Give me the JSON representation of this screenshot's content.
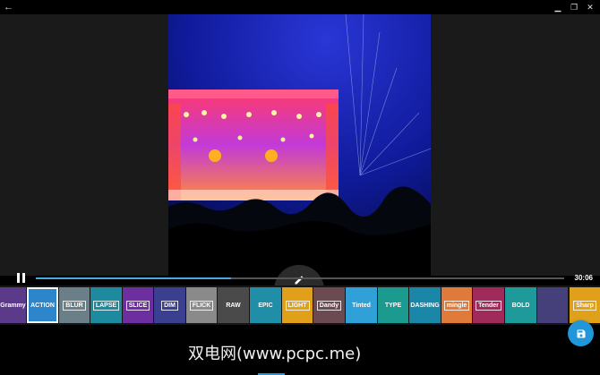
{
  "window": {
    "back_icon": "arrow-left-icon",
    "controls": [
      "minimize-icon",
      "restore-icon",
      "close-icon"
    ]
  },
  "player": {
    "state": "playing",
    "duration": "30:06",
    "progress": 0.37,
    "accent": "#4aa8e0"
  },
  "filters": [
    {
      "label": "Grammy",
      "bg": "#5b3a8a",
      "selected": false
    },
    {
      "label": "ACTION",
      "bg": "#2d86c9",
      "selected": true
    },
    {
      "label": "BLUR",
      "bg": "#6a7f88",
      "selected": false
    },
    {
      "label": "LAPSE",
      "bg": "#1d8aa0",
      "selected": false
    },
    {
      "label": "SLICE",
      "bg": "#6d2fa0",
      "selected": false
    },
    {
      "label": "DIM",
      "bg": "#3a3f8f",
      "selected": false
    },
    {
      "label": "FLICK",
      "bg": "#8a8a8a",
      "selected": false
    },
    {
      "label": "RAW",
      "bg": "#4a4a4a",
      "selected": false
    },
    {
      "label": "EPIC",
      "bg": "#1f8ea6",
      "selected": false
    },
    {
      "label": "LIGHT",
      "bg": "#e0a01a",
      "selected": false
    },
    {
      "label": "Dandy",
      "bg": "#6b4a52",
      "selected": false
    },
    {
      "label": "Tinted",
      "bg": "#2fa0d8",
      "selected": false
    },
    {
      "label": "TYPE",
      "bg": "#1b9a8f",
      "selected": false
    },
    {
      "label": "DASHING",
      "bg": "#1a86a8",
      "selected": false
    },
    {
      "label": "mingle",
      "bg": "#e07a3a",
      "selected": false
    },
    {
      "label": "Tender",
      "bg": "#a02a5a",
      "selected": false
    },
    {
      "label": "BOLD",
      "bg": "#1f9a9a",
      "selected": false
    },
    {
      "label": "",
      "bg": "#46407a",
      "selected": false
    },
    {
      "label": "Sharp",
      "bg": "#e0a01a",
      "selected": false
    }
  ],
  "watermark": "双电网(www.pcpc.me)",
  "fab": {
    "edit_icon": "pencil-icon",
    "save_icon": "save-icon",
    "color": "#2196d8"
  }
}
